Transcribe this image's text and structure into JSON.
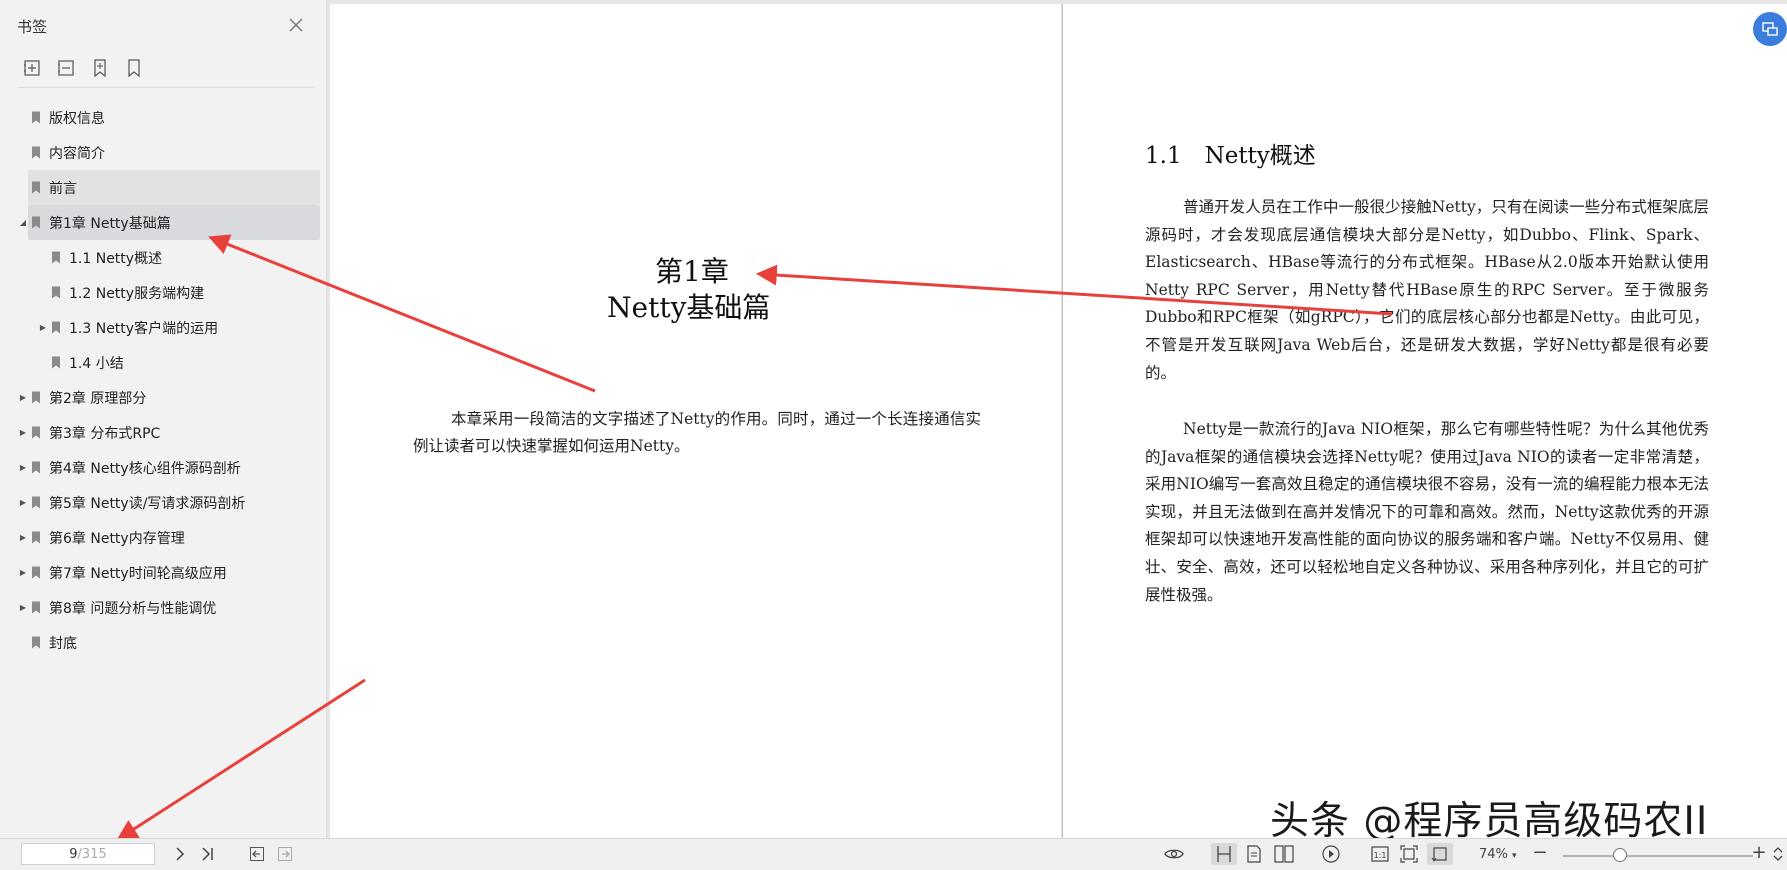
{
  "sidebar": {
    "title": "书签",
    "tools": [
      "add-bookmark-icon",
      "remove-bookmark-icon",
      "bookmark-star-icon",
      "bookmark-outline-icon"
    ],
    "items": [
      {
        "label": "版权信息",
        "level": 0,
        "expander": "none",
        "state": "normal"
      },
      {
        "label": "内容简介",
        "level": 0,
        "expander": "none",
        "state": "normal"
      },
      {
        "label": "前言",
        "level": 0,
        "expander": "none",
        "state": "hover"
      },
      {
        "label": "第1章 Netty基础篇",
        "level": 0,
        "expander": "expanded",
        "state": "selected"
      },
      {
        "label": "1.1 Netty概述",
        "level": 1,
        "expander": "none",
        "state": "normal"
      },
      {
        "label": "1.2 Netty服务端构建",
        "level": 1,
        "expander": "none",
        "state": "normal"
      },
      {
        "label": "1.3 Netty客户端的运用",
        "level": 1,
        "expander": "collapsed",
        "state": "normal"
      },
      {
        "label": "1.4 小结",
        "level": 1,
        "expander": "none",
        "state": "normal"
      },
      {
        "label": "第2章 原理部分",
        "level": 0,
        "expander": "collapsed",
        "state": "normal"
      },
      {
        "label": "第3章 分布式RPC",
        "level": 0,
        "expander": "collapsed",
        "state": "normal"
      },
      {
        "label": "第4章 Netty核心组件源码剖析",
        "level": 0,
        "expander": "collapsed",
        "state": "normal"
      },
      {
        "label": "第5章 Netty读/写请求源码剖析",
        "level": 0,
        "expander": "collapsed",
        "state": "normal"
      },
      {
        "label": "第6章 Netty内存管理",
        "level": 0,
        "expander": "collapsed",
        "state": "normal"
      },
      {
        "label": "第7章 Netty时间轮高级应用",
        "level": 0,
        "expander": "collapsed",
        "state": "normal"
      },
      {
        "label": "第8章 问题分析与性能调优",
        "level": 0,
        "expander": "collapsed",
        "state": "normal"
      },
      {
        "label": "封底",
        "level": 0,
        "expander": "none",
        "state": "normal"
      }
    ]
  },
  "left_page": {
    "chapter_number": "第1章",
    "chapter_title": "Netty基础篇",
    "description": "本章采用一段简洁的文字描述了Netty的作用。同时，通过一个长连接通信实例让读者可以快速掌握如何运用Netty。"
  },
  "right_page": {
    "section_title": "1.1　Netty概述",
    "paragraphs": [
      "普通开发人员在工作中一般很少接触Netty，只有在阅读一些分布式框架底层源码时，才会发现底层通信模块大部分是Netty，如Dubbo、Flink、Spark、Elasticsearch、HBase等流行的分布式框架。HBase从2.0版本开始默认使用Netty RPC Server，用Netty替代HBase原生的RPC Server。至于微服务Dubbo和RPC框架（如gRPC），它们的底层核心部分也都是Netty。由此可见，不管是开发互联网Java Web后台，还是研发大数据，学好Netty都是很有必要的。",
      "Netty是一款流行的Java NIO框架，那么它有哪些特性呢？为什么其他优秀的Java框架的通信模块会选择Netty呢？使用过Java NIO的读者一定非常清楚，采用NIO编写一套高效且稳定的通信模块很不容易，没有一流的编程能力根本无法实现，并且无法做到在高并发情况下的可靠和高效。然而，Netty这款优秀的开源框架却可以快速地开发高性能的面向协议的服务端和客户端。Netty不仅易用、健壮、安全、高效，还可以轻松地自定义各种协议、采用各种序列化，并且它的可扩展性极强。"
    ]
  },
  "watermark": "头条 @程序员高级码农II",
  "toolbar": {
    "current_page": "9",
    "total_pages": "/315",
    "zoom": "74%",
    "zoom_fraction": 0.3,
    "view_buttons": [
      "eye-icon",
      "single-page-icon",
      "continuous-page-icon",
      "two-page-icon",
      "play-icon",
      "actual-size-icon",
      "fit-page-icon",
      "fit-width-icon"
    ],
    "zoom_out": "−",
    "zoom_in": "+"
  },
  "colors": {
    "accent": "#3b7ddd",
    "annotation_arrow": "#e8413c",
    "selected_bg": "#d8dade"
  }
}
